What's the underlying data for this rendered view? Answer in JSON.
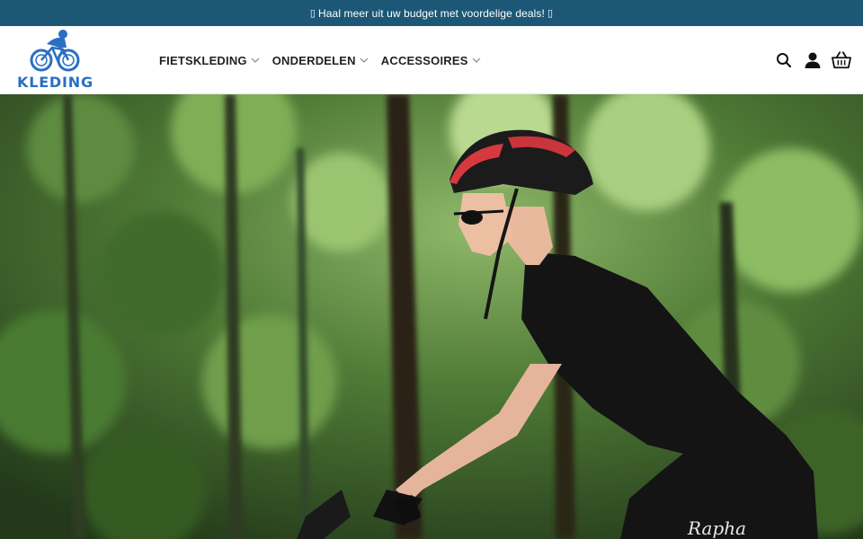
{
  "promo": {
    "text": "Haal meer uit uw budget met voordelige deals!",
    "left_glyph": "▯",
    "right_glyph": "▯"
  },
  "logo": {
    "text": "KLEDING",
    "icon": "cyclist-icon"
  },
  "nav": {
    "items": [
      {
        "label": "FIETSKLEDING"
      },
      {
        "label": "ONDERDELEN"
      },
      {
        "label": "ACCESSOIRES"
      }
    ]
  },
  "header_icons": [
    "search-icon",
    "account-icon",
    "cart-basket-icon"
  ],
  "hero": {
    "image": "cyclist-in-forest-photo",
    "jersey_print": "Rapha"
  },
  "colors": {
    "topbar": "#1c5776",
    "logo": "#2a6fc4",
    "nav_text": "#222222"
  }
}
